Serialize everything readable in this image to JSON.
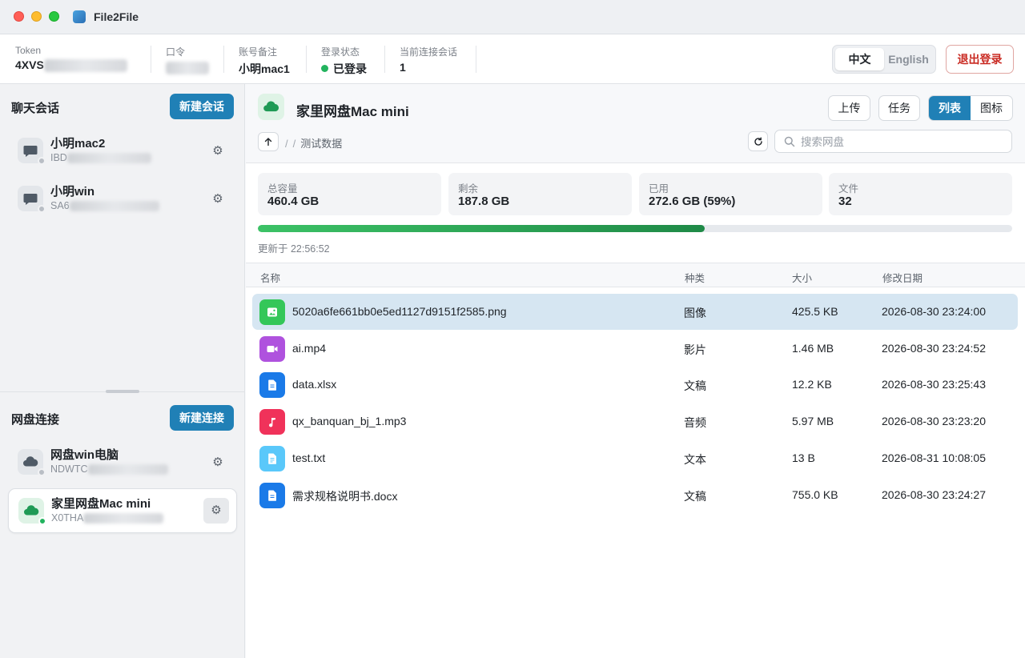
{
  "app": {
    "title": "File2File"
  },
  "header": {
    "token": {
      "label": "Token",
      "value": "4XVS"
    },
    "password": {
      "label": "口令"
    },
    "note": {
      "label": "账号备注",
      "value": "小明mac1"
    },
    "login": {
      "label": "登录状态",
      "value": "已登录",
      "color": "#22b35e"
    },
    "sessions": {
      "label": "当前连接会话",
      "value": "1"
    },
    "lang": {
      "zh": "中文",
      "en": "English",
      "selected": "zh"
    },
    "logout": "退出登录"
  },
  "sidebar": {
    "chats": {
      "title": "聊天会话",
      "new_label": "新建会话",
      "items": [
        {
          "name": "小明mac2",
          "sub": "IBD",
          "icon": "chat-bubble-icon",
          "online": false
        },
        {
          "name": "小明win",
          "sub": "SA6",
          "icon": "chat-bubble-icon",
          "online": false
        }
      ]
    },
    "drives": {
      "title": "网盘连接",
      "new_label": "新建连接",
      "items": [
        {
          "name": "网盘win电脑",
          "sub": "NDWTC",
          "icon": "cloud-icon",
          "online": false
        },
        {
          "name": "家里网盘Mac mini",
          "sub": "X0THA",
          "icon": "cloud-icon",
          "online": true,
          "active": true
        }
      ]
    }
  },
  "main": {
    "title": "家里网盘Mac mini",
    "buttons": {
      "upload": "上传",
      "tasks": "任务",
      "list": "列表",
      "grid": "图标",
      "view": "list"
    },
    "breadcrumb": {
      "sep": "/",
      "folder": "测试数据"
    },
    "search_placeholder": "搜索网盘",
    "stats": [
      {
        "label": "总容量",
        "value": "460.4 GB"
      },
      {
        "label": "剩余",
        "value": "187.8 GB"
      },
      {
        "label": "已用",
        "value": "272.6 GB (59%)"
      },
      {
        "label": "文件",
        "value": "32"
      }
    ],
    "usage_fraction": 0.592,
    "updated": "更新于 22:56:52",
    "columns": {
      "name": "名称",
      "kind": "种类",
      "size": "大小",
      "modified": "修改日期"
    },
    "files": [
      {
        "name": "5020a6fe661bb0e5ed1127d9151f2585.png",
        "kind": "图像",
        "size": "425.5 KB",
        "modified": "2026-08-30 23:24:00",
        "icon": "image-icon",
        "color": "#34c759",
        "selected": true
      },
      {
        "name": "ai.mp4",
        "kind": "影片",
        "size": "1.46 MB",
        "modified": "2026-08-30 23:24:52",
        "icon": "video-icon",
        "color": "#af52de"
      },
      {
        "name": "data.xlsx",
        "kind": "文稿",
        "size": "12.2 KB",
        "modified": "2026-08-30 23:25:43",
        "icon": "document-icon",
        "color": "#1a7ae8"
      },
      {
        "name": "qx_banquan_bj_1.mp3",
        "kind": "音频",
        "size": "5.97 MB",
        "modified": "2026-08-30 23:23:20",
        "icon": "music-note-icon",
        "color": "#f0325a"
      },
      {
        "name": "test.txt",
        "kind": "文本",
        "size": "13 B",
        "modified": "2026-08-31 10:08:05",
        "icon": "text-file-icon",
        "color": "#5ac8fa"
      },
      {
        "name": "需求规格说明书.docx",
        "kind": "文稿",
        "size": "755.0 KB",
        "modified": "2026-08-30 23:24:27",
        "icon": "document-icon",
        "color": "#1a7ae8"
      }
    ]
  }
}
